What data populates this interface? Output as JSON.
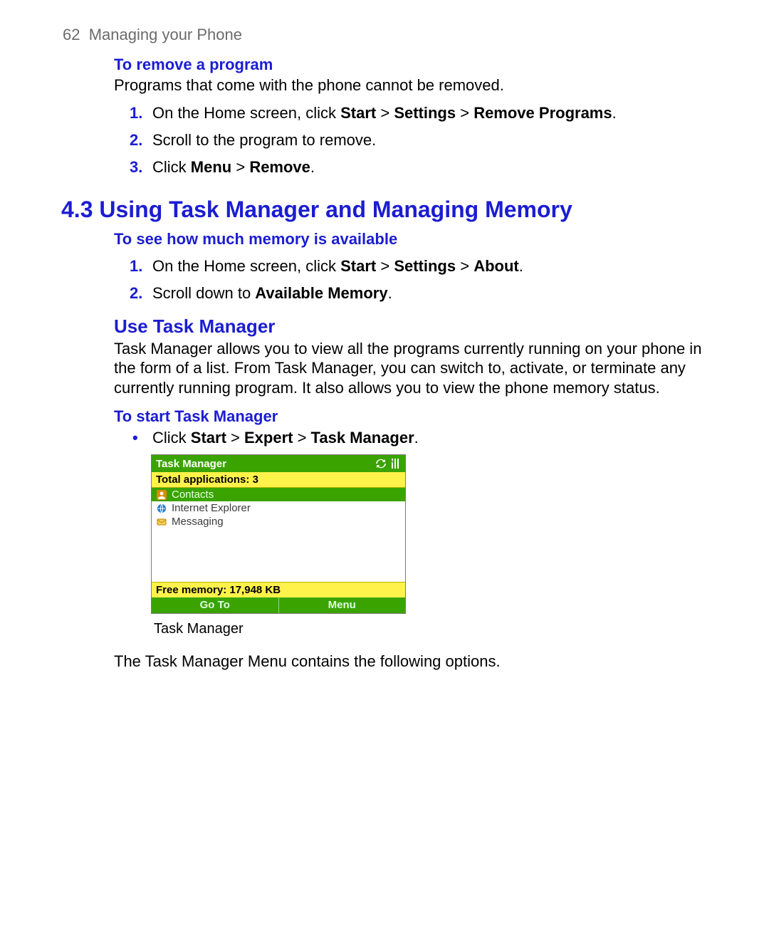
{
  "page": {
    "number": "62",
    "chapter_title": "Managing your Phone"
  },
  "remove_program": {
    "heading": "To remove a program",
    "intro": "Programs that come with the phone cannot be removed.",
    "steps": [
      {
        "marker": "1.",
        "pre": "On the Home screen, click ",
        "b1": "Start",
        "sep1": " > ",
        "b2": "Settings",
        "sep2": " > ",
        "b3": "Remove Programs",
        "post": "."
      },
      {
        "marker": "2.",
        "pre": "Scroll to the program to remove.",
        "b1": "",
        "sep1": "",
        "b2": "",
        "sep2": "",
        "b3": "",
        "post": ""
      },
      {
        "marker": "3.",
        "pre": "Click ",
        "b1": "Menu",
        "sep1": " > ",
        "b2": "Remove",
        "sep2": "",
        "b3": "",
        "post": "."
      }
    ]
  },
  "section43": {
    "heading": "4.3 Using Task Manager and Managing Memory"
  },
  "memory": {
    "heading": "To see how much memory is available",
    "steps": [
      {
        "marker": "1.",
        "pre": "On the Home screen, click ",
        "b1": "Start",
        "sep1": " > ",
        "b2": "Settings",
        "sep2": " > ",
        "b3": "About",
        "post": "."
      },
      {
        "marker": "2.",
        "pre": "Scroll down to ",
        "b1": "Available Memory",
        "sep1": "",
        "b2": "",
        "sep2": "",
        "b3": "",
        "post": "."
      }
    ]
  },
  "use_tm": {
    "heading": "Use Task Manager",
    "body": "Task Manager allows you to view all the programs currently running on your phone in the form of a list. From Task Manager, you can switch to, activate, or terminate any currently running program. It also allows you to view the phone memory status."
  },
  "start_tm": {
    "heading": "To start Task Manager",
    "bullet": {
      "pre": "Click ",
      "b1": "Start",
      "sep1": " > ",
      "b2": "Expert",
      "sep2": " > ",
      "b3": "Task Manager",
      "post": "."
    }
  },
  "screenshot": {
    "title": "Task Manager",
    "total_label": "Total applications: 3",
    "apps": [
      {
        "name": "Contacts",
        "icon": "contacts-icon",
        "selected": true
      },
      {
        "name": "Internet Explorer",
        "icon": "ie-icon",
        "selected": false
      },
      {
        "name": "Messaging",
        "icon": "messaging-icon",
        "selected": false
      }
    ],
    "free_label": "Free memory: 17,948 KB",
    "softkey_left": "Go To",
    "softkey_right": "Menu",
    "caption": "Task Manager"
  },
  "after_fig_text": "The Task Manager Menu contains the following options."
}
